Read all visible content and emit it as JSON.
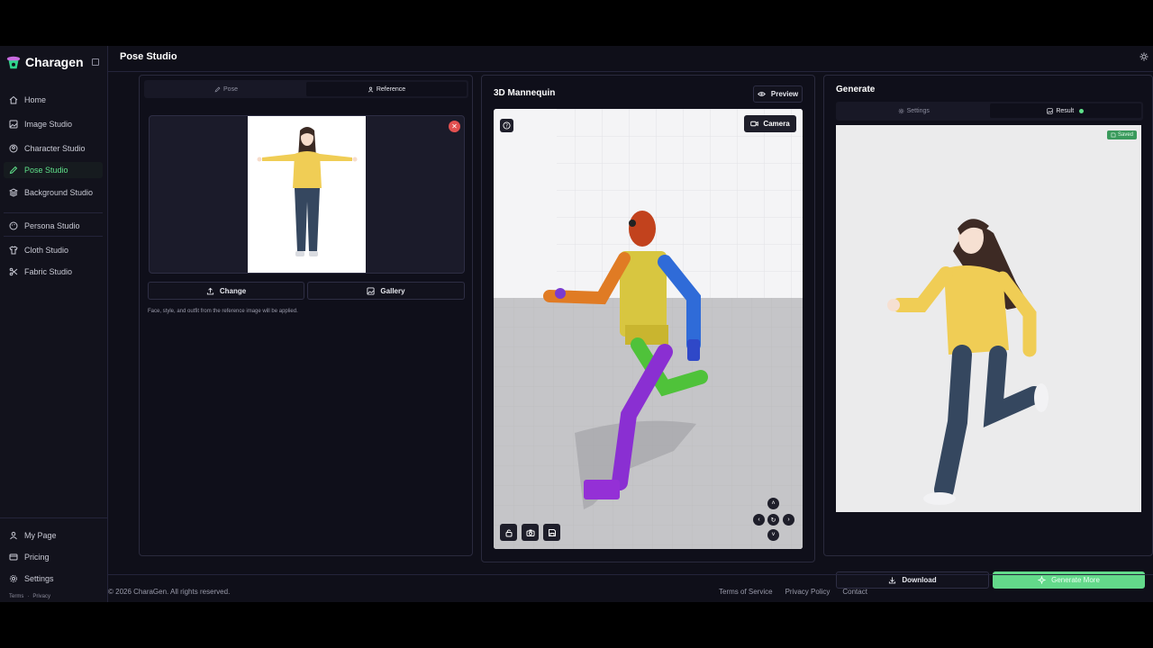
{
  "app": {
    "name": "Charagen"
  },
  "header": {
    "title": "Pose Studio"
  },
  "sidebar": {
    "items": [
      {
        "label": "Home",
        "icon": "home-icon"
      },
      {
        "label": "Image Studio",
        "icon": "image-icon"
      },
      {
        "label": "Character Studio",
        "icon": "user-circle-icon"
      },
      {
        "label": "Pose Studio",
        "icon": "pencil-icon",
        "active": true
      },
      {
        "label": "Background Studio",
        "icon": "layers-icon"
      },
      {
        "label": "Persona Studio",
        "icon": "palette-icon"
      },
      {
        "label": "Cloth Studio",
        "icon": "shirt-icon"
      },
      {
        "label": "Fabric Studio",
        "icon": "scissors-icon"
      }
    ],
    "bottom_items": [
      {
        "label": "My Page",
        "icon": "user-icon"
      },
      {
        "label": "Pricing",
        "icon": "card-icon"
      },
      {
        "label": "Settings",
        "icon": "gear-icon"
      }
    ],
    "legal": {
      "terms": "Terms",
      "sep": "·",
      "privacy": "Privacy"
    }
  },
  "left_panel": {
    "tabs": [
      {
        "label": "Pose"
      },
      {
        "label": "Reference",
        "active": true
      }
    ],
    "change_label": "Change",
    "gallery_label": "Gallery",
    "hint": "Face, style, and outfit from the reference image will be applied."
  },
  "mannequin": {
    "title": "3D Mannequin",
    "preview_label": "Preview",
    "camera_label": "Camera"
  },
  "generate": {
    "title": "Generate",
    "tabs": [
      {
        "label": "Settings"
      },
      {
        "label": "Result",
        "active": true
      }
    ],
    "saved_label": "Saved",
    "download_label": "Download",
    "generate_more_label": "Generate More"
  },
  "footer": {
    "copyright": "© 2026 CharaGen. All rights reserved.",
    "links": [
      "Terms of Service",
      "Privacy Policy",
      "Contact"
    ]
  },
  "colors": {
    "accent": "#5fe08a",
    "generate_button": "#63d98a",
    "danger": "#e25050"
  }
}
